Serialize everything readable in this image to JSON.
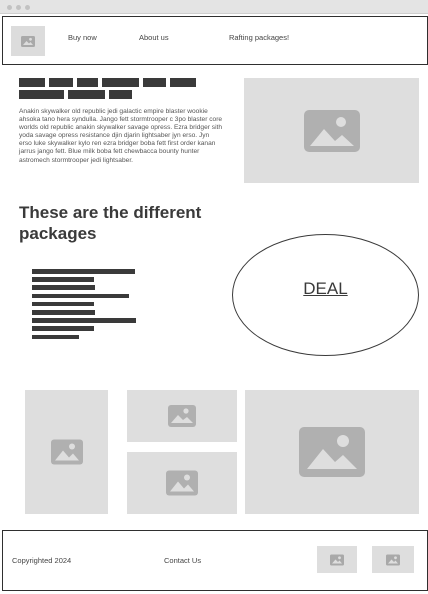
{
  "nav": {
    "logo_icon": "image-placeholder-icon",
    "links": [
      "Buy now",
      "About us",
      "Rafting packages!"
    ]
  },
  "intro": {
    "paragraph": "Anakin skywalker old republic jedi galactic empire blaster wookie ahsoka tano hera syndulla. Jango fett stormtrooper c 3po blaster core worlds old republic anakin skywalker savage opress. Ezra bridger sith yoda savage opress resistance djin djarin lightsaber jyn erso. Jyn erso luke skywalker kylo ren ezra bridger boba fett first order kanan jarrus jango fett. Blue milk boba fett chewbacca bounty hunter astromech stormtrooper jedi lightsaber."
  },
  "packages": {
    "heading": "These are the different packages",
    "deal_label": "DEAL"
  },
  "footer": {
    "copyright": "Copyrighted 2024",
    "contact": "Contact Us"
  },
  "colors": {
    "placeholder": "#dedede",
    "ink": "#3a3a3a",
    "border": "#2f2f2f"
  }
}
